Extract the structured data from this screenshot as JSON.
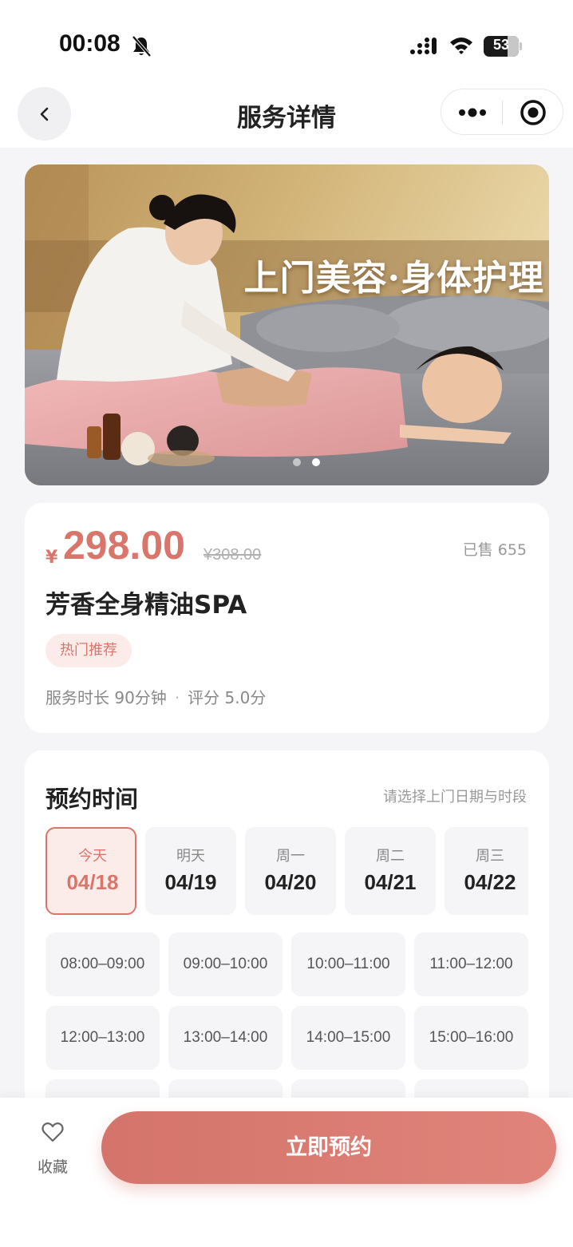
{
  "status_bar": {
    "time": "00:08",
    "battery": "53"
  },
  "nav": {
    "title": "服务详情"
  },
  "banner": {
    "title": "上门美容·身体护理",
    "slide_count": 2,
    "active_slide": 2
  },
  "product": {
    "currency": "¥",
    "price": "298.00",
    "original_price": "¥308.00",
    "sold": "已售 655",
    "name": "芳香全身精油SPA",
    "tag": "热门推荐",
    "duration": "服务时长 90分钟",
    "separator": "·",
    "rating": "评分 5.0分"
  },
  "booking": {
    "title": "预约时间",
    "hint": "请选择上门日期与时段",
    "dates": [
      {
        "weekday": "今天",
        "date": "04/18",
        "selected": true
      },
      {
        "weekday": "明天",
        "date": "04/19",
        "selected": false
      },
      {
        "weekday": "周一",
        "date": "04/20",
        "selected": false
      },
      {
        "weekday": "周二",
        "date": "04/21",
        "selected": false
      },
      {
        "weekday": "周三",
        "date": "04/22",
        "selected": false
      }
    ],
    "slots": [
      "08:00–09:00",
      "09:00–10:00",
      "10:00–11:00",
      "11:00–12:00",
      "12:00–13:00",
      "13:00–14:00",
      "14:00–15:00",
      "15:00–16:00"
    ]
  },
  "bottom": {
    "favorite_label": "收藏",
    "book_label": "立即预约"
  },
  "colors": {
    "accent": "#d9756a",
    "accent_light": "#fbece9",
    "background": "#f5f5f7"
  }
}
